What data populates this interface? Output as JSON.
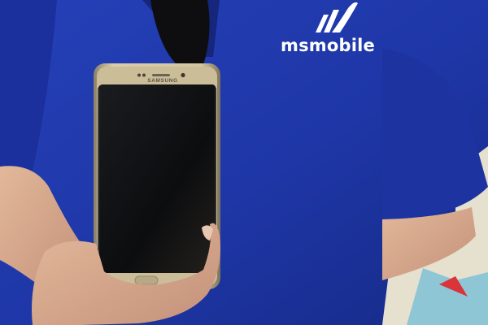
{
  "photo": {
    "shirt_logo": {
      "text": "msmobile"
    },
    "phone": {
      "brand": "SAMSUNG"
    },
    "colors": {
      "shirt": "#1e36a6",
      "shirt_shadow": "#14247a",
      "phone_frame": "#cfc19d",
      "phone_screen": "#0f1012",
      "skin": "#d7a98a",
      "background_wall": "#e9e2d2"
    }
  }
}
